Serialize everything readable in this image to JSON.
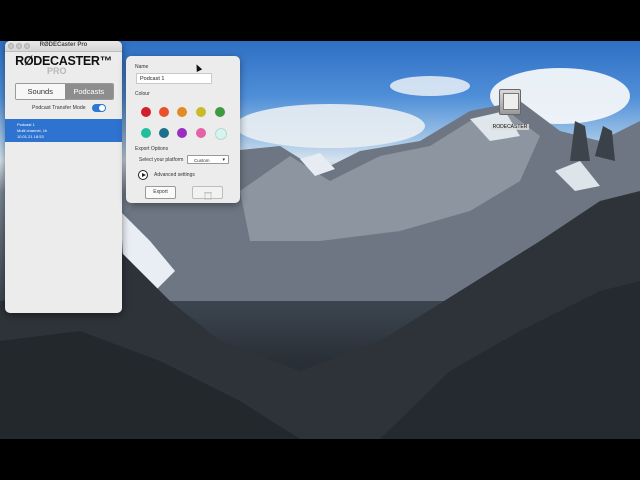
{
  "app": {
    "window_title": "RØDECaster Pro",
    "logo_main": "RØDECASTER™",
    "logo_sub": "PRO"
  },
  "segment": {
    "sounds_label": "Sounds",
    "podcasts_label": "Podcasts",
    "selected": "Podcasts"
  },
  "transfer": {
    "label": "Podcast Transfer Mode",
    "enabled": true
  },
  "podcast_list": [
    {
      "title": "Podcast 1",
      "subtitle": "Multi channel, 1h",
      "date": "10.01.21 18:53"
    }
  ],
  "detail": {
    "name_label": "Name",
    "name_value": "Podcast 1",
    "colour_label": "Colour",
    "colours": [
      "#d2202a",
      "#e9502a",
      "#e08b24",
      "#c8bb27",
      "#3f9a3f",
      "#1fbf9e",
      "#1d6f8c",
      "#9a2ec0",
      "#e561a8",
      "#d7f3ef"
    ],
    "export_options_label": "Export Options",
    "platform_label": "Select your platform",
    "platform_value": "Custom",
    "advanced_label": "Advanced settings",
    "export_button": "Export"
  },
  "desktop": {
    "drive_label": "RODECASTER"
  }
}
